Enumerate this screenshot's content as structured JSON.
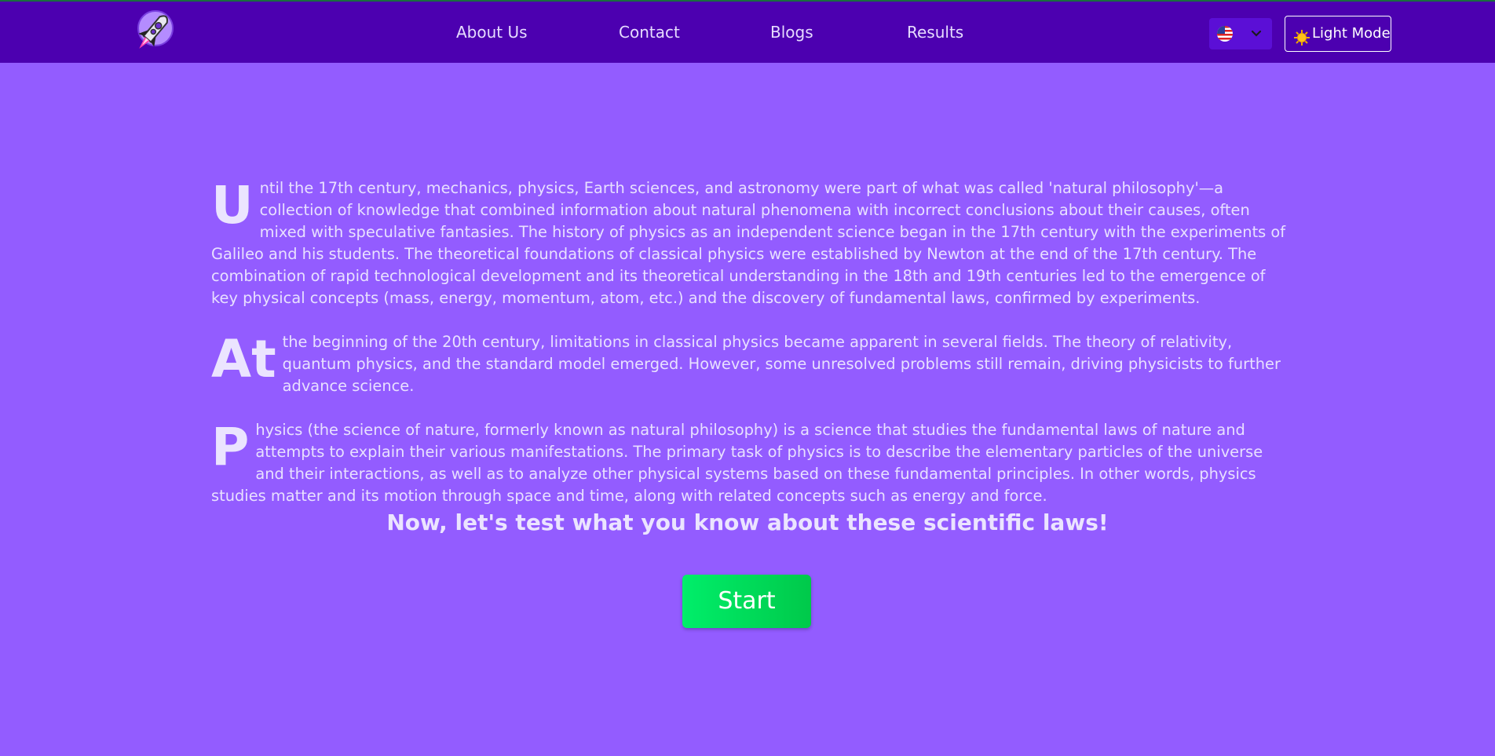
{
  "nav": {
    "links": [
      {
        "label": "About Us"
      },
      {
        "label": "Contact"
      },
      {
        "label": "Blogs"
      },
      {
        "label": "Results"
      }
    ],
    "language": {
      "selected": "English (US)",
      "flag_icon": "us-flag-icon"
    },
    "mode_button": {
      "label": "Light Mode",
      "icon": "sun-icon"
    }
  },
  "content": {
    "paragraphs": [
      {
        "dropcap": "U",
        "text": "ntil the 17th century, mechanics, physics, Earth sciences, and astronomy were part of what was called 'natural philosophy'—a collection of knowledge that combined information about natural phenomena with incorrect conclusions about their causes, often mixed with speculative fantasies. The history of physics as an independent science began in the 17th century with the experiments of Galileo and his students. The theoretical foundations of classical physics were established by Newton at the end of the 17th century. The combination of rapid technological development and its theoretical understanding in the 18th and 19th centuries led to the emergence of key physical concepts (mass, energy, momentum, atom, etc.) and the discovery of fundamental laws, confirmed by experiments."
      },
      {
        "dropcap": "At",
        "text": "the beginning of the 20th century, limitations in classical physics became apparent in several fields. The theory of relativity, quantum physics, and the standard model emerged. However, some unresolved problems still remain, driving physicists to further advance science."
      },
      {
        "dropcap": "P",
        "text": "hysics (the science of nature, formerly known as natural philosophy) is a science that studies the fundamental laws of nature and attempts to explain their various manifestations. The primary task of physics is to describe the elementary particles of the universe and their interactions, as well as to analyze other physical systems based on these fundamental principles. In other words, physics studies matter and its motion through space and time, along with related concepts such as energy and force."
      }
    ]
  },
  "cta": {
    "heading": "Now, let's test what you know about these scientific laws!",
    "start_label": "Start"
  },
  "colors": {
    "nav_bg": "#4c00b0",
    "page_bg": "#935cff",
    "start_button": "#00e060"
  }
}
